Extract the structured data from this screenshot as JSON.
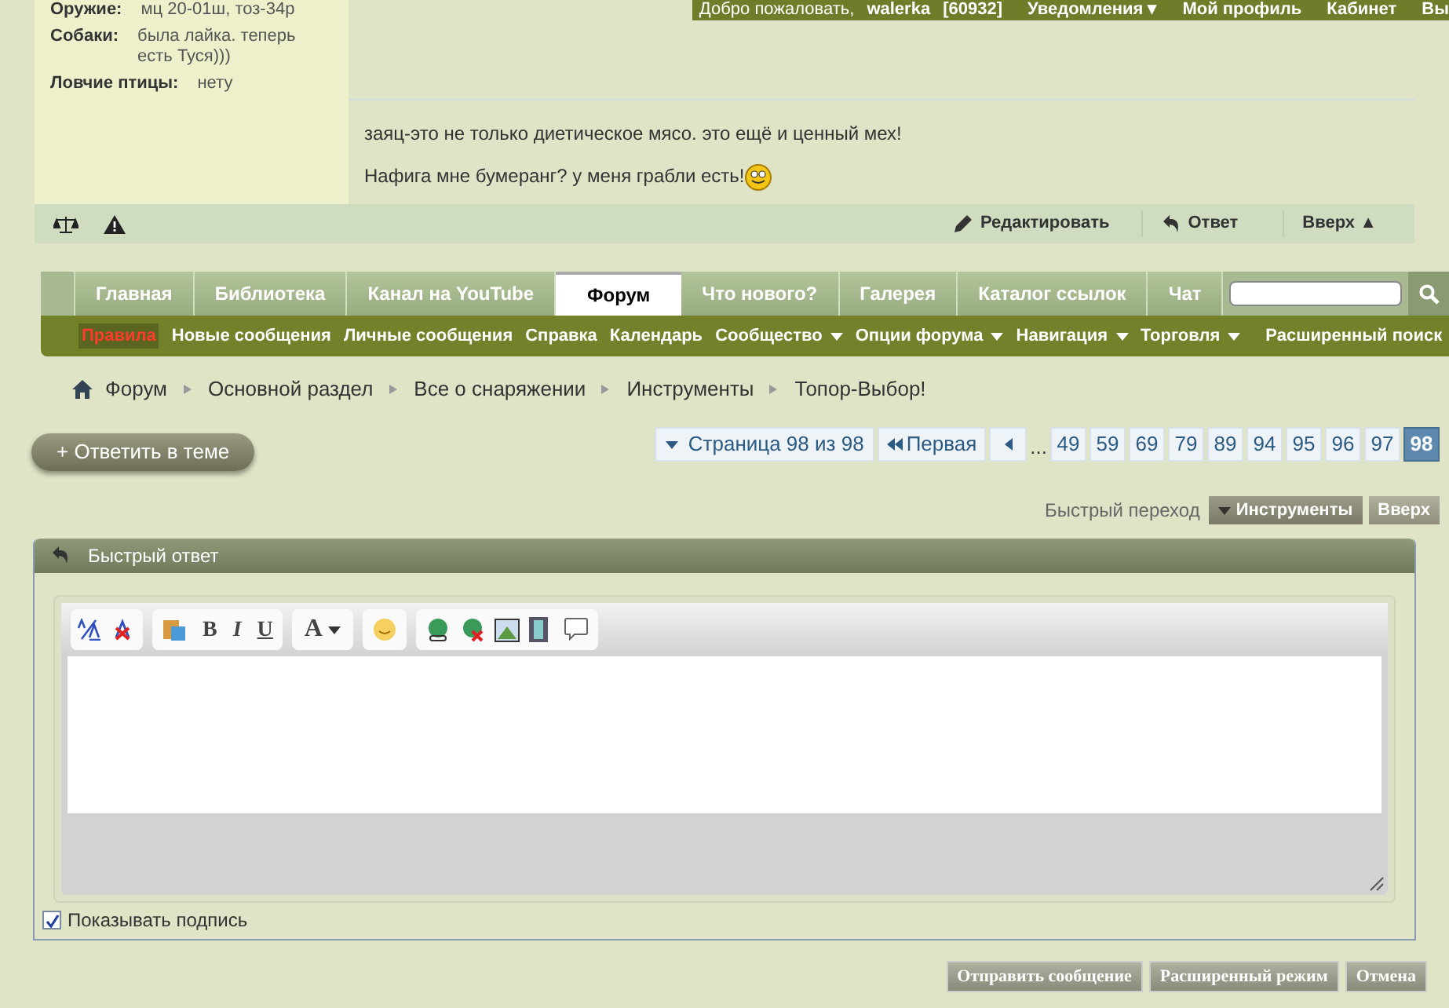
{
  "post": {
    "profile_fields": [
      {
        "label": "Оружие:",
        "value": "мц 20-01ш, тоз-34р"
      },
      {
        "label": "Собаки:",
        "value": "была лайка. теперь есть Туся)))"
      },
      {
        "label": "Ловчие птицы:",
        "value": "нету"
      }
    ],
    "message": [
      "заяц-это не только диетическое мясо. это ещё и ценный мех!",
      "Нафига мне бумеранг? у меня грабли есть!"
    ],
    "actions": [
      "Редактировать",
      "Ответ",
      "Вверх ▲"
    ]
  },
  "user_bar": {
    "greeting": "Добро пожаловать,",
    "username": "walerka",
    "id": "[60932]",
    "links": [
      "Уведомления ▾",
      "Мой профиль",
      "Кабинет",
      "Вы"
    ]
  },
  "tabs": [
    {
      "label": "Главная",
      "selected": false
    },
    {
      "label": "Библиотека",
      "selected": false
    },
    {
      "label": "Канал на YouTube",
      "selected": false
    },
    {
      "label": "Форум",
      "selected": true
    },
    {
      "label": "Что нового?",
      "selected": false
    },
    {
      "label": "Галерея",
      "selected": false
    },
    {
      "label": "Каталог ссылок",
      "selected": false
    },
    {
      "label": "Чат",
      "selected": false
    }
  ],
  "submenu": [
    {
      "label": "Правила",
      "kind": "alert"
    },
    {
      "label": "Новые сообщения",
      "kind": "link"
    },
    {
      "label": "Личные сообщения",
      "kind": "link"
    },
    {
      "label": "Справка",
      "kind": "link"
    },
    {
      "label": "Календарь",
      "kind": "link"
    },
    {
      "label": "Сообщество",
      "kind": "menu"
    },
    {
      "label": "Опции форума",
      "kind": "menu"
    },
    {
      "label": "Навигация",
      "kind": "menu"
    },
    {
      "label": "Торговля",
      "kind": "menu"
    }
  ],
  "advanced_search": "Расширенный поиск",
  "breadcrumbs": [
    "Форум",
    "Основной раздел",
    "Все о снаряжении",
    "Инструменты",
    "Топор-Выбор!"
  ],
  "reply_button": "+ Ответить в теме",
  "pagination": {
    "page_label": "Страница 98 из 98",
    "first": "Первая",
    "ellipsis": "...",
    "pages": [
      {
        "label": "49",
        "selected": false
      },
      {
        "label": "59",
        "selected": false
      },
      {
        "label": "69",
        "selected": false
      },
      {
        "label": "79",
        "selected": false
      },
      {
        "label": "89",
        "selected": false
      },
      {
        "label": "94",
        "selected": false
      },
      {
        "label": "95",
        "selected": false
      },
      {
        "label": "96",
        "selected": false
      },
      {
        "label": "97",
        "selected": false
      },
      {
        "label": "98",
        "selected": true
      }
    ]
  },
  "quick_nav": {
    "label": "Быстрый переход",
    "tools": "Инструменты",
    "top": "Вверх"
  },
  "quick_reply": {
    "title": "Быстрый ответ",
    "format_buttons": [
      "B",
      "I",
      "U",
      "A"
    ],
    "show_signature": {
      "label": "Показывать подпись",
      "checked": true
    },
    "buttons": [
      "Отправить сообщение",
      "Расширенный режим",
      "Отмена"
    ]
  }
}
